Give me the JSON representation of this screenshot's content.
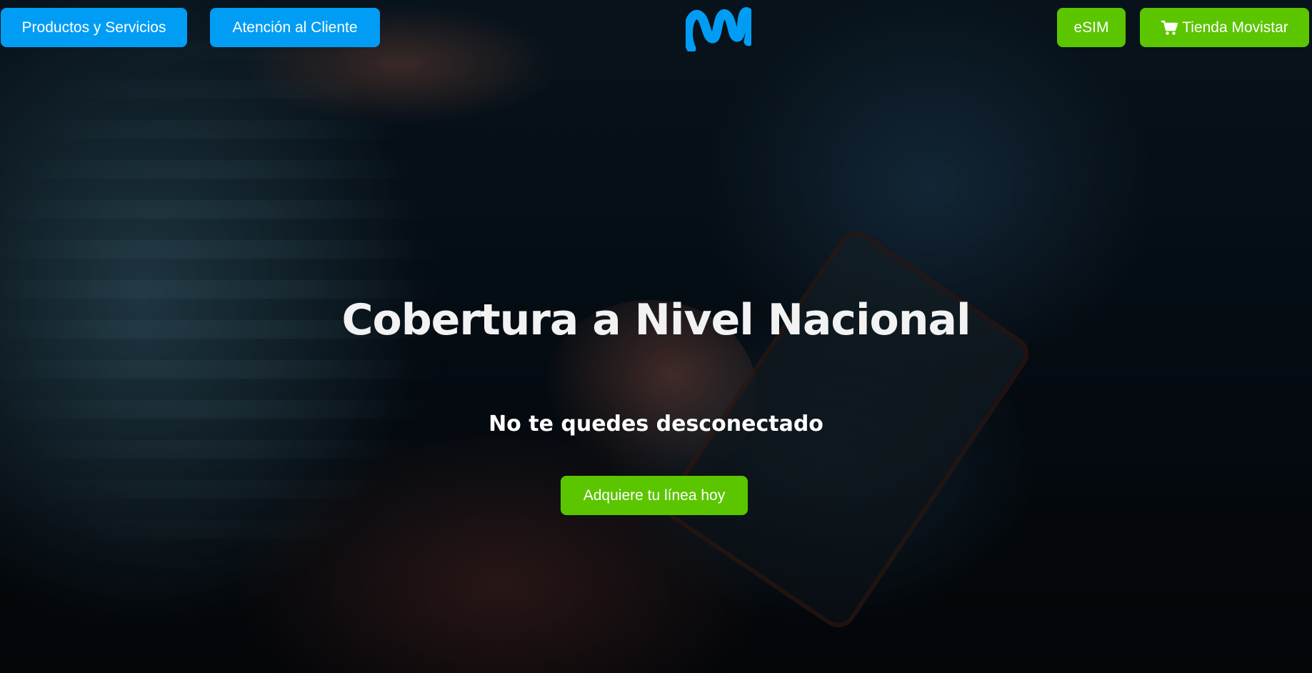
{
  "nav": {
    "left_buttons": [
      {
        "label": "Productos y Servicios"
      },
      {
        "label": "Atención al Cliente"
      }
    ],
    "right_buttons": [
      {
        "label": "eSIM"
      },
      {
        "label": "Tienda Movistar",
        "icon": "cart-icon"
      }
    ],
    "logo": {
      "icon": "movistar-logo-icon"
    }
  },
  "hero": {
    "headline": "Cobertura a Nivel Nacional",
    "subheadline": "No te quedes desconectado",
    "cta_label": "Adquiere tu línea hoy"
  },
  "colors": {
    "blue": "#019df4",
    "green": "#5bc500",
    "text": "#ffffff"
  }
}
